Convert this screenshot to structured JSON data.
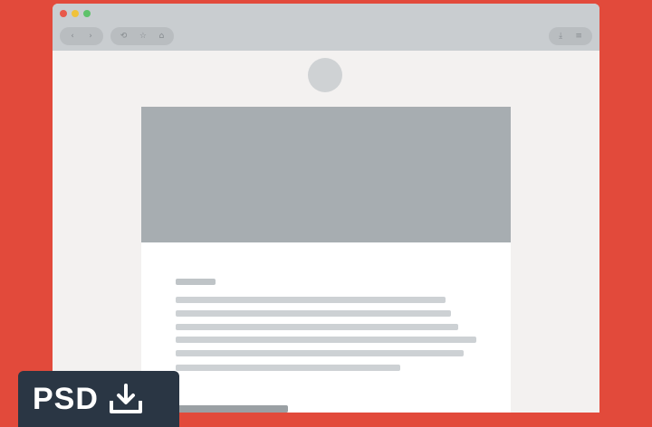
{
  "browser": {
    "nav_buttons": [
      "‹",
      "›"
    ],
    "tool_buttons": [
      "⟲",
      "☆",
      "⌂"
    ],
    "right_buttons": [
      "⤓",
      "≡"
    ]
  },
  "badge": {
    "label": "PSD",
    "icon": "download-icon"
  },
  "colors": {
    "background": "#e24a3b",
    "badge": "#2a3644"
  }
}
